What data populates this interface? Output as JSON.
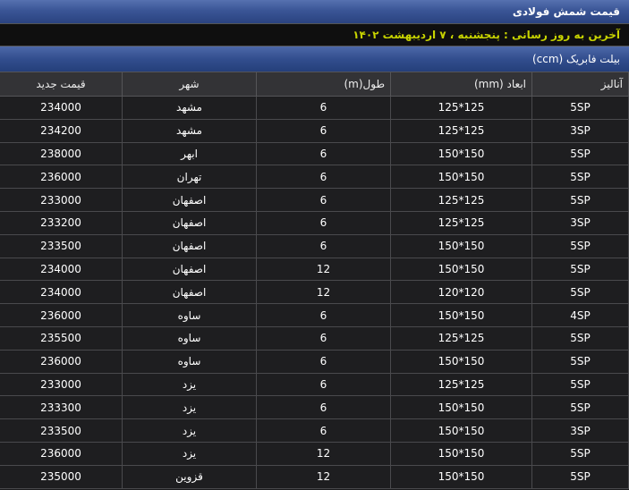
{
  "header": {
    "title": "قیمت شمش فولادی",
    "last_update": "آخرین به روز رسانی : پنجشنبه ، ۷ اردیبهشت ۱۴۰۲"
  },
  "section": {
    "title": "بیلت فابریک (ccm)"
  },
  "table": {
    "columns": [
      "آنالیز",
      "ابعاد (mm)",
      "طول(m)",
      "شهر",
      "قیمت جدید"
    ],
    "rows": [
      [
        "5SP",
        "125*125",
        "6",
        "مشهد",
        "234000"
      ],
      [
        "3SP",
        "125*125",
        "6",
        "مشهد",
        "234200"
      ],
      [
        "5SP",
        "150*150",
        "6",
        "ابهر",
        "238000"
      ],
      [
        "5SP",
        "150*150",
        "6",
        "تهران",
        "236000"
      ],
      [
        "5SP",
        "125*125",
        "6",
        "اصفهان",
        "233000"
      ],
      [
        "3SP",
        "125*125",
        "6",
        "اصفهان",
        "233200"
      ],
      [
        "5SP",
        "150*150",
        "6",
        "اصفهان",
        "233500"
      ],
      [
        "5SP",
        "150*150",
        "12",
        "اصفهان",
        "234000"
      ],
      [
        "5SP",
        "120*120",
        "12",
        "اصفهان",
        "234000"
      ],
      [
        "4SP",
        "150*150",
        "6",
        "ساوه",
        "236000"
      ],
      [
        "5SP",
        "125*125",
        "6",
        "ساوه",
        "235500"
      ],
      [
        "5SP",
        "150*150",
        "6",
        "ساوه",
        "236000"
      ],
      [
        "5SP",
        "125*125",
        "6",
        "یزد",
        "233000"
      ],
      [
        "5SP",
        "150*150",
        "6",
        "یزد",
        "233300"
      ],
      [
        "3SP",
        "150*150",
        "6",
        "یزد",
        "233500"
      ],
      [
        "5SP",
        "150*150",
        "12",
        "یزد",
        "236000"
      ],
      [
        "5SP",
        "150*150",
        "12",
        "قزوین",
        "235000"
      ]
    ]
  }
}
